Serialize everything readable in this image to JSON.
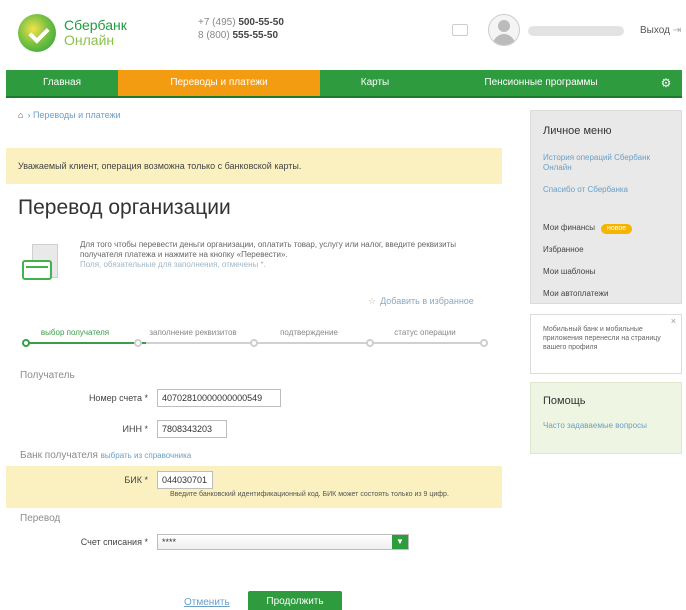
{
  "header": {
    "logo_line1": "Сбербанк",
    "logo_line2": "Онлайн",
    "phone1_prefix": "+7 (495)",
    "phone1_number": "500-55-50",
    "phone2_prefix": "8 (800)",
    "phone2_number": "555-55-50",
    "logout": "Выход"
  },
  "nav": {
    "items": [
      {
        "label": "Главная",
        "active": false
      },
      {
        "label": "Переводы и платежи",
        "active": true
      },
      {
        "label": "Карты",
        "active": false
      },
      {
        "label": "Пенсионные программы",
        "active": false
      }
    ]
  },
  "breadcrumb": {
    "label": "Переводы и платежи"
  },
  "alert": {
    "text": "Уважаемый клиент, операция возможна только с банковской карты."
  },
  "page": {
    "title": "Перевод организации",
    "intro": "Для того чтобы перевести деньги организации, оплатить товар, услугу или налог, введите реквизиты получателя платежа и нажмите на кнопку «Перевести».",
    "required_note": "Поля, обязательные для заполнения, отмечены *.",
    "add_favorite": "Добавить в избранное"
  },
  "steps": [
    {
      "label": "выбор получателя",
      "done": true
    },
    {
      "label": "заполнение реквизитов",
      "done": false
    },
    {
      "label": "подтверждение",
      "done": false
    },
    {
      "label": "статус операции",
      "done": false
    }
  ],
  "form": {
    "recipient_section": "Получатель",
    "account_label": "Номер счета",
    "account_value": "40702810000000000549",
    "inn_label": "ИНН",
    "inn_value": "7808343203",
    "bank_section": "Банк получателя",
    "bank_directory_link": "выбрать из справочника",
    "bik_label": "БИК",
    "bik_value": "044030701",
    "bik_hint": "Введите банковский идентификационный код. БИК может состоять только из 9 цифр.",
    "transfer_section": "Перевод",
    "debit_account_label": "Счет списания",
    "debit_account_value": "****",
    "required_mark": "*"
  },
  "actions": {
    "cancel": "Отменить",
    "submit": "Продолжить"
  },
  "sidebar": {
    "menu_title": "Личное меню",
    "history": "История операций Сбербанк Онлайн",
    "thanks": "Спасибо от Сбербанка",
    "finances": "Мои финансы",
    "finances_badge": "новое",
    "favorites": "Избранное",
    "templates": "Мои шаблоны",
    "autopayments": "Мои автоплатежи",
    "promo_text": "Мобильный банк и мобильные приложения перенесли на страницу вашего профиля",
    "promo_close": "×",
    "help_title": "Помощь",
    "help_faq": "Часто задаваемые вопросы"
  }
}
